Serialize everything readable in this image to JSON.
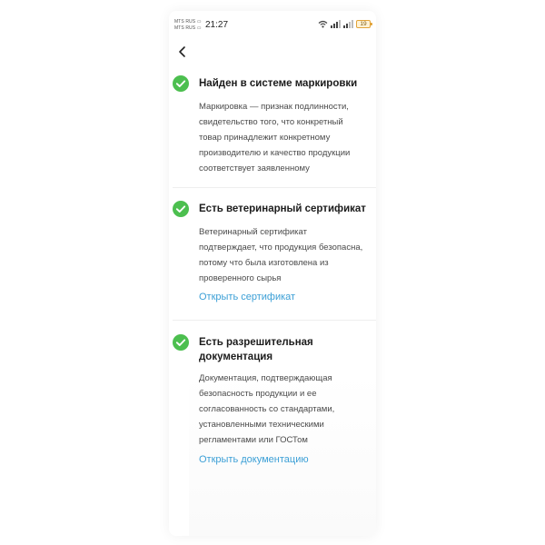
{
  "status_bar": {
    "carrier_1": "MTS RUS",
    "carrier_2": "MTS RUS",
    "time": "21:27",
    "battery": "19"
  },
  "sections": [
    {
      "title": "Найден в системе маркировки",
      "description_lines": [
        "Маркировка — признак подлинности,",
        "свидетельство того, что конкретный",
        "товар принадлежит конкретному",
        "производителю и качество продукции",
        "соответствует заявленному"
      ]
    },
    {
      "title": "Есть ветеринарный сертификат",
      "description_lines": [
        "Ветеринарный сертификат",
        "подтверждает, что продукция безопасна,",
        "потому что была изготовлена из",
        "проверенного сырья"
      ],
      "link": "Открыть сертификат"
    },
    {
      "title_lines": [
        "Есть разрешительная",
        "документация"
      ],
      "description_lines": [
        "Документация, подтверждающая",
        "безопасность продукции и ее",
        "согласованность со стандартами,",
        "установленными техническими",
        "регламентами или ГОСТом"
      ],
      "link": "Открыть документацию"
    }
  ],
  "colors": {
    "check_green": "#4cbf4f",
    "link_blue": "#3b9fd6",
    "text_dark": "#1c1c1c",
    "text_body": "#4a4a4a"
  }
}
